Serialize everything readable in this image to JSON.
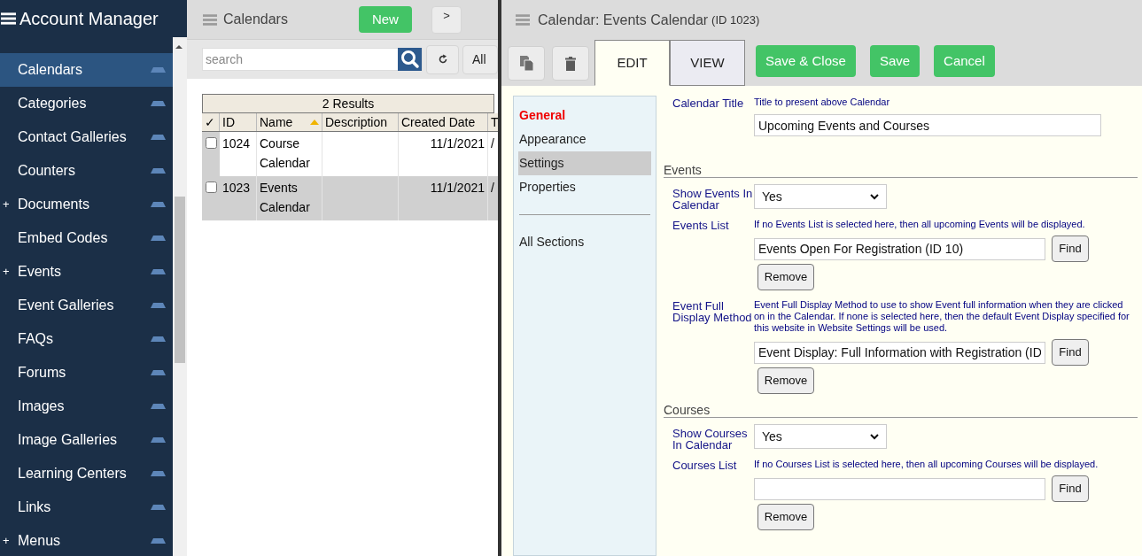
{
  "sidebar": {
    "title": "Account Manager",
    "items": [
      {
        "label": "Calendars",
        "selected": true
      },
      {
        "label": "Categories",
        "selected": false
      },
      {
        "label": "Contact Galleries",
        "selected": false
      },
      {
        "label": "Counters",
        "selected": false
      },
      {
        "label": "Documents",
        "selected": false,
        "expander": "+"
      },
      {
        "label": "Embed Codes",
        "selected": false
      },
      {
        "label": "Events",
        "selected": false,
        "expander": "+"
      },
      {
        "label": "Event Galleries",
        "selected": false
      },
      {
        "label": "FAQs",
        "selected": false
      },
      {
        "label": "Forums",
        "selected": false
      },
      {
        "label": "Images",
        "selected": false
      },
      {
        "label": "Image Galleries",
        "selected": false
      },
      {
        "label": "Learning Centers",
        "selected": false
      },
      {
        "label": "Links",
        "selected": false
      },
      {
        "label": "Menus",
        "selected": false,
        "expander": "+"
      }
    ]
  },
  "list_panel": {
    "title": "Calendars",
    "new_button": "New",
    "toggle_button": ">",
    "search": {
      "placeholder": "search"
    },
    "all_button": "All",
    "results": "2 Results",
    "columns": [
      {
        "label": "✓"
      },
      {
        "label": "ID"
      },
      {
        "label": "Name",
        "sorted": true
      },
      {
        "label": "Description"
      },
      {
        "label": "Created Date"
      },
      {
        "label": "T"
      }
    ],
    "rows": [
      {
        "selected": false,
        "checked": false,
        "id": "1024",
        "name": "Course Calendar",
        "description": "",
        "created": "11/1/2021",
        "column_6": "/"
      },
      {
        "selected": true,
        "checked": false,
        "id": "1023",
        "name": "Events Calendar",
        "description": "",
        "created": "11/1/2021",
        "column_6": "/"
      }
    ]
  },
  "editor": {
    "title": "Calendar: Events Calendar",
    "id_label": "(ID 1023)",
    "tabs": [
      {
        "label": "EDIT",
        "selected": true
      },
      {
        "label": "VIEW",
        "selected": false
      }
    ],
    "actions": [
      "Save & Close",
      "Save",
      "Cancel"
    ],
    "sections_nav": [
      {
        "label": "General",
        "kind": "group",
        "selected": false
      },
      {
        "label": "Appearance",
        "kind": "link",
        "selected": false
      },
      {
        "label": "Settings",
        "kind": "link",
        "selected": true
      },
      {
        "label": "Properties",
        "kind": "link",
        "selected": false
      },
      {
        "label": "All Sections",
        "kind": "all",
        "selected": false
      }
    ],
    "form": [
      {
        "kind": "field",
        "label": "Calendar Title",
        "hint": "Title to present above Calendar",
        "value": "Upcoming Events and Courses"
      },
      {
        "kind": "section",
        "title": "Events"
      },
      {
        "kind": "select",
        "label": "Show Events In Calendar",
        "value": "Yes"
      },
      {
        "kind": "picker",
        "label": "Events List",
        "hint": "If no Events List is selected here, then all upcoming Events will be displayed.",
        "value": "Events Open For Registration (ID 10)",
        "find": "Find",
        "remove": "Remove"
      },
      {
        "kind": "picker",
        "label": "Event Full Display Method",
        "hint": "Event Full Display Method to use to show Event full information when they are clicked on in the Calendar. If none is selected here, then the default Event Display specified for this website in Website Settings will be used.",
        "value": "Event Display: Full Information with Registration (ID",
        "find": "Find",
        "remove": "Remove"
      },
      {
        "kind": "section",
        "title": "Courses"
      },
      {
        "kind": "select",
        "label": "Show Courses In Calendar",
        "value": "Yes"
      },
      {
        "kind": "picker",
        "label": "Courses List",
        "hint": "If no Courses List is selected here, then all upcoming Courses will be displayed.",
        "find": "Find",
        "remove": "Remove"
      }
    ]
  }
}
